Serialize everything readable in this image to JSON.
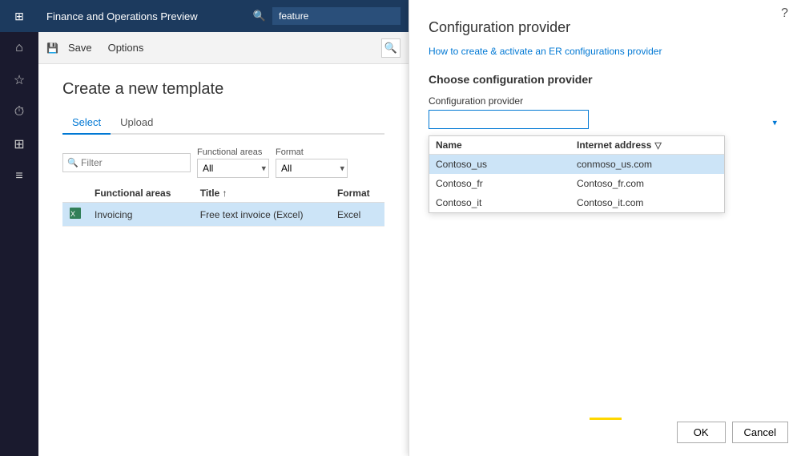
{
  "app": {
    "title": "Finance and Operations Preview",
    "search_placeholder": "feature"
  },
  "toolbar": {
    "save_label": "Save",
    "options_label": "Options"
  },
  "page": {
    "title": "Create a new template",
    "tabs": [
      {
        "label": "Select",
        "active": true
      },
      {
        "label": "Upload",
        "active": false
      }
    ],
    "filter_placeholder": "Filter",
    "functional_areas_label": "Functional areas",
    "functional_areas_value": "All",
    "format_label": "Format",
    "format_value": "All",
    "table": {
      "columns": [
        {
          "label": "Functional areas"
        },
        {
          "label": "Title ↑"
        },
        {
          "label": "Format"
        }
      ],
      "rows": [
        {
          "icon": "📄",
          "functional_area": "Invoicing",
          "title": "Free text invoice (Excel)",
          "format": "Excel",
          "selected": true
        }
      ]
    }
  },
  "panel": {
    "title": "Configuration provider",
    "link_text": "How to create & activate an ER configurations provider",
    "section_title": "Choose configuration provider",
    "config_label": "Configuration provider",
    "dropdown": {
      "name_col": "Name",
      "address_col": "Internet address",
      "rows": [
        {
          "name": "Contoso_us",
          "address": "conmoso_us.com",
          "selected": true
        },
        {
          "name": "Contoso_fr",
          "address": "Contoso_fr.com",
          "selected": false
        },
        {
          "name": "Contoso_it",
          "address": "Contoso_it.com",
          "selected": false
        }
      ]
    },
    "ok_label": "OK",
    "cancel_label": "Cancel",
    "help_label": "?"
  },
  "nav": {
    "icons": [
      "≡",
      "⌂",
      "☆",
      "⏱",
      "⊞",
      "≡"
    ]
  }
}
